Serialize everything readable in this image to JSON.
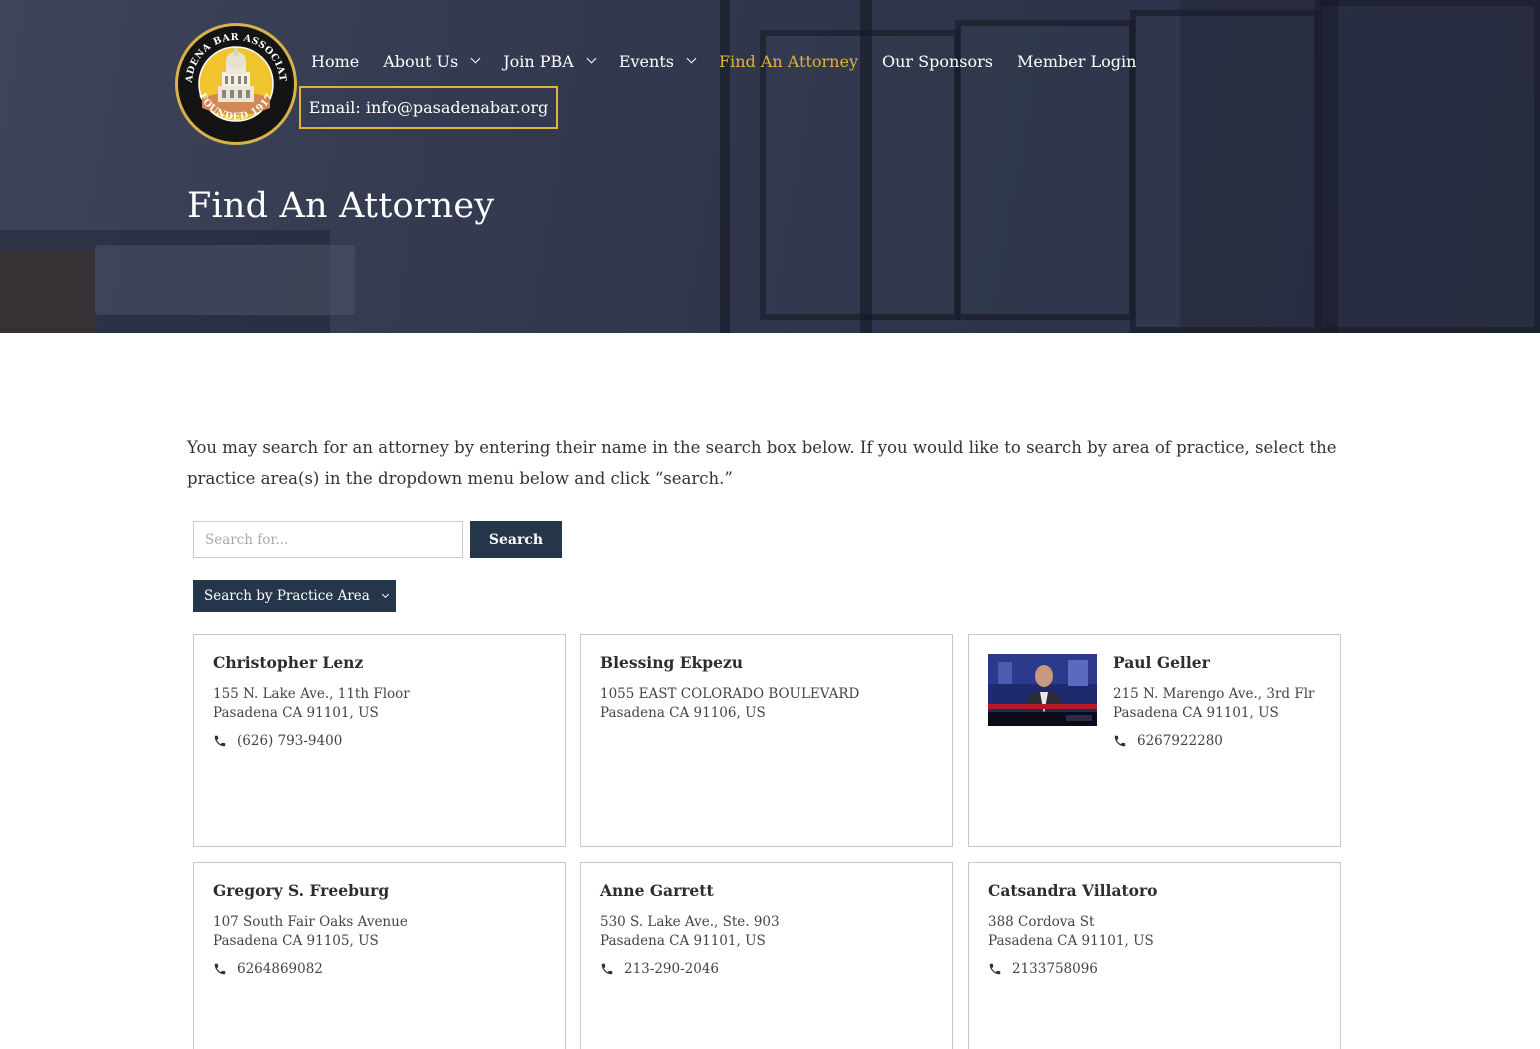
{
  "brand": {
    "logo_top_text": "PASADENA BAR ASSOCIATION",
    "logo_bottom_text": "FOUNDED 1917"
  },
  "nav": {
    "items": [
      {
        "label": "Home",
        "dropdown": false,
        "active": false
      },
      {
        "label": "About Us",
        "dropdown": true,
        "active": false
      },
      {
        "label": "Join PBA",
        "dropdown": true,
        "active": false
      },
      {
        "label": "Events",
        "dropdown": true,
        "active": false
      },
      {
        "label": "Find An Attorney",
        "dropdown": false,
        "active": true
      },
      {
        "label": "Our Sponsors",
        "dropdown": false,
        "active": false
      },
      {
        "label": "Member Login",
        "dropdown": false,
        "active": false
      }
    ],
    "email": "Email: info@pasadenabar.org"
  },
  "page": {
    "title": "Find An Attorney",
    "intro": "You may search for an attorney by entering their name in the search box below. If you would like to search by area of practice, select the practice area(s) in the dropdown menu below and click “search.”"
  },
  "search": {
    "placeholder": "Search for...",
    "value": "",
    "button_label": "Search",
    "practice_label": "Search by Practice Area"
  },
  "attorneys": [
    {
      "name": "Christopher Lenz",
      "address1": "155 N. Lake Ave., 11th Floor",
      "address2": "Pasadena CA 91101, US",
      "phone": "(626) 793-9400",
      "has_photo": false
    },
    {
      "name": "Blessing Ekpezu",
      "address1": "1055 EAST COLORADO BOULEVARD",
      "address2": "Pasadena CA 91106, US",
      "phone": "",
      "has_photo": false
    },
    {
      "name": "Paul Geller",
      "address1": "215 N. Marengo Ave., 3rd Flr",
      "address2": "Pasadena CA 91101, US",
      "phone": "6267922280",
      "has_photo": true
    },
    {
      "name": "Gregory S. Freeburg",
      "address1": "107 South Fair Oaks Avenue",
      "address2": "Pasadena CA 91105, US",
      "phone": "6264869082",
      "has_photo": false
    },
    {
      "name": "Anne Garrett",
      "address1": "530 S. Lake Ave., Ste. 903",
      "address2": "Pasadena CA 91101, US",
      "phone": "213-290-2046",
      "has_photo": false
    },
    {
      "name": "Catsandra Villatoro",
      "address1": "388 Cordova St",
      "address2": "Pasadena CA 91101, US",
      "phone": "2133758096",
      "has_photo": false
    }
  ],
  "icons": {
    "phone": "phone-icon",
    "dropdown": "chevron-down-icon",
    "logo": "pba-seal-logo"
  },
  "colors": {
    "accent": "#e0b33a",
    "button": "#25364a",
    "hero": "#30364b"
  }
}
